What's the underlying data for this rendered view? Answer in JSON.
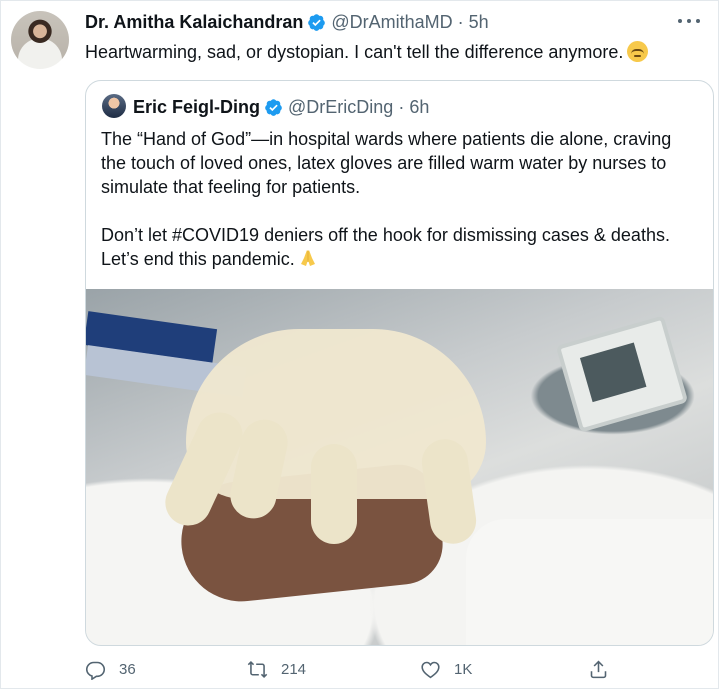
{
  "tweet": {
    "author_name": "Dr. Amitha Kalaichandran",
    "handle": "@DrAmithaMD",
    "separator": "·",
    "time": "5h",
    "text": "Heartwarming, sad, or dystopian. I can't tell the difference anymore."
  },
  "quoted": {
    "author_name": "Eric Feigl-Ding",
    "handle": "@DrEricDing",
    "separator": "·",
    "time": "6h",
    "paragraph1": "The “Hand of God”—in hospital wards where patients die alone, craving\nthe touch of loved ones, latex gloves are filled warm water by nurses to\nsimulate that feeling for patients.",
    "paragraph2": "Don’t let #COVID19 deniers off the hook for dismissing cases & deaths.\nLet’s end this pandemic."
  },
  "actions": {
    "reply_count": "36",
    "retweet_count": "214",
    "like_count": "1K"
  },
  "colors": {
    "verified": "#1d9bf0",
    "muted_text": "#536471",
    "border": "#cfd9de"
  }
}
